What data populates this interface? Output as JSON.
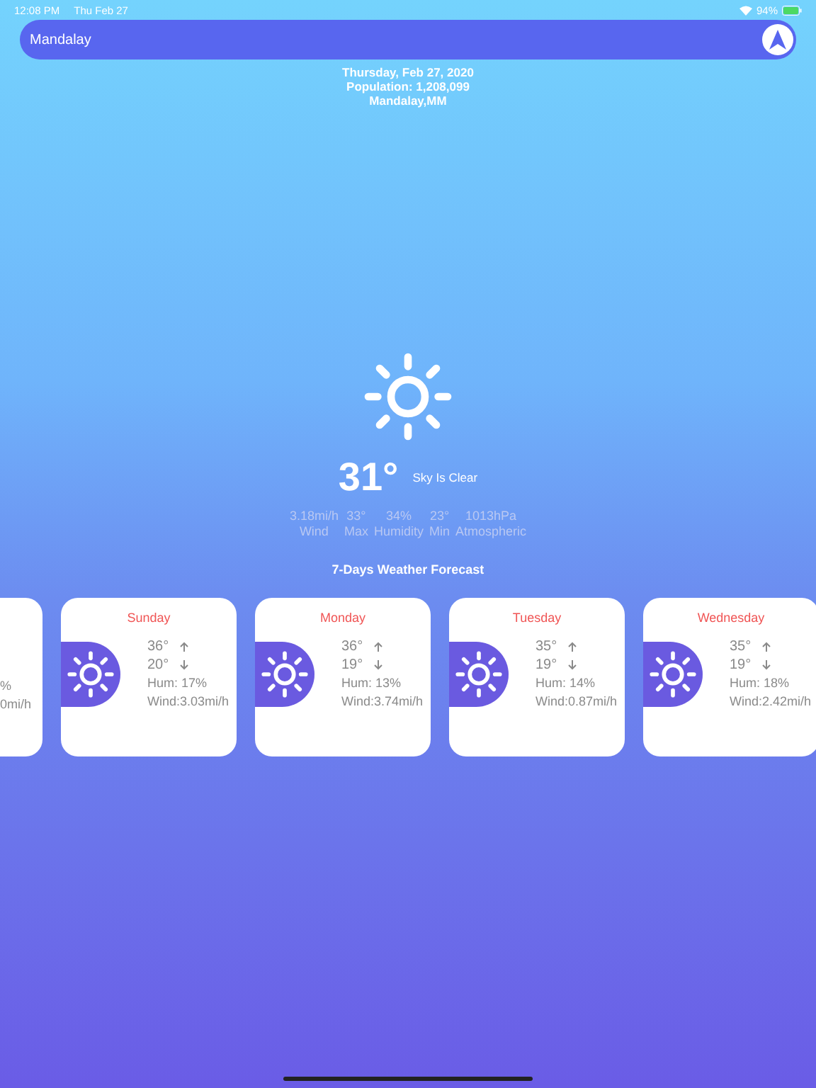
{
  "status_bar": {
    "time": "12:08 PM",
    "date": "Thu Feb 27",
    "battery": "94%"
  },
  "search": {
    "value": "Mandalay"
  },
  "info": [
    "Thursday, Feb 27, 2020",
    "Population: 1,208,099",
    "Mandalay,MM"
  ],
  "current": {
    "temperature": "31°",
    "summary": "Sky Is Clear"
  },
  "stats": [
    {
      "value": "3.18mi/h",
      "label": "Wind"
    },
    {
      "value": "33°",
      "label": "Max"
    },
    {
      "value": "34%",
      "label": "Humidity"
    },
    {
      "value": "23°",
      "label": "Min"
    },
    {
      "value": "1013hPa",
      "label": "Atmospheric"
    }
  ],
  "forecast_title": "7-Days Weather Forecast",
  "partial_card": {
    "humidity": "%",
    "wind": "0mi/h"
  },
  "forecast": [
    {
      "day": "Sunday",
      "max": "36°",
      "min": "20°",
      "humidity": "Hum: 17%",
      "wind": "Wind:3.03mi/h"
    },
    {
      "day": "Monday",
      "max": "36°",
      "min": "19°",
      "humidity": "Hum: 13%",
      "wind": "Wind:3.74mi/h"
    },
    {
      "day": "Tuesday",
      "max": "35°",
      "min": "19°",
      "humidity": "Hum: 14%",
      "wind": "Wind:0.87mi/h"
    },
    {
      "day": "Wednesday",
      "max": "35°",
      "min": "19°",
      "humidity": "Hum: 18%",
      "wind": "Wind:2.42mi/h"
    }
  ]
}
